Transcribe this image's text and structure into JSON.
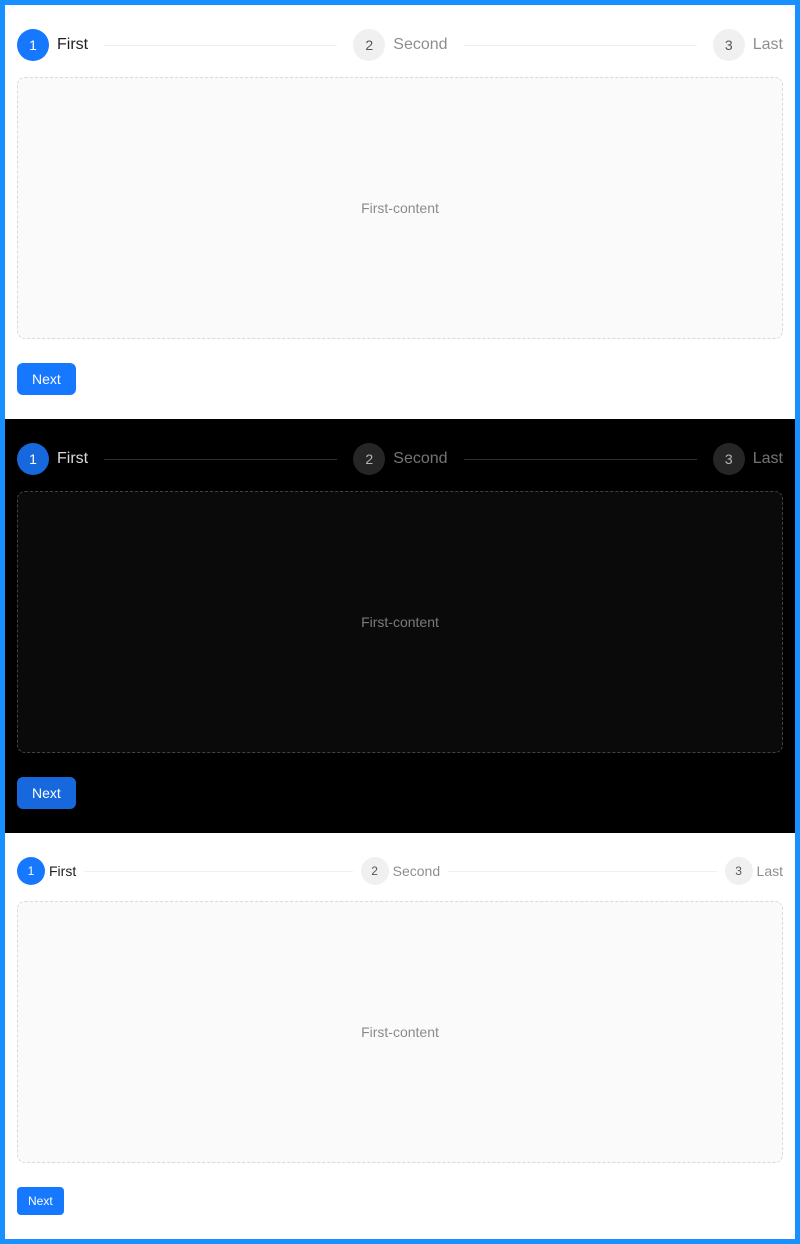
{
  "demos": [
    {
      "theme": "light",
      "steps": [
        {
          "number": "1",
          "title": "First",
          "status": "active"
        },
        {
          "number": "2",
          "title": "Second",
          "status": "wait"
        },
        {
          "number": "3",
          "title": "Last",
          "status": "wait"
        }
      ],
      "content": "First-content",
      "next_label": "Next"
    },
    {
      "theme": "dark",
      "steps": [
        {
          "number": "1",
          "title": "First",
          "status": "active"
        },
        {
          "number": "2",
          "title": "Second",
          "status": "wait"
        },
        {
          "number": "3",
          "title": "Last",
          "status": "wait"
        }
      ],
      "content": "First-content",
      "next_label": "Next"
    },
    {
      "theme": "small",
      "steps": [
        {
          "number": "1",
          "title": "First",
          "status": "active"
        },
        {
          "number": "2",
          "title": "Second",
          "status": "wait"
        },
        {
          "number": "3",
          "title": "Last",
          "status": "wait"
        }
      ],
      "content": "First-content",
      "next_label": "Next"
    }
  ],
  "colors": {
    "frame": "#1890ff",
    "primary": "#1677ff",
    "primary_dark": "#1668dc"
  }
}
